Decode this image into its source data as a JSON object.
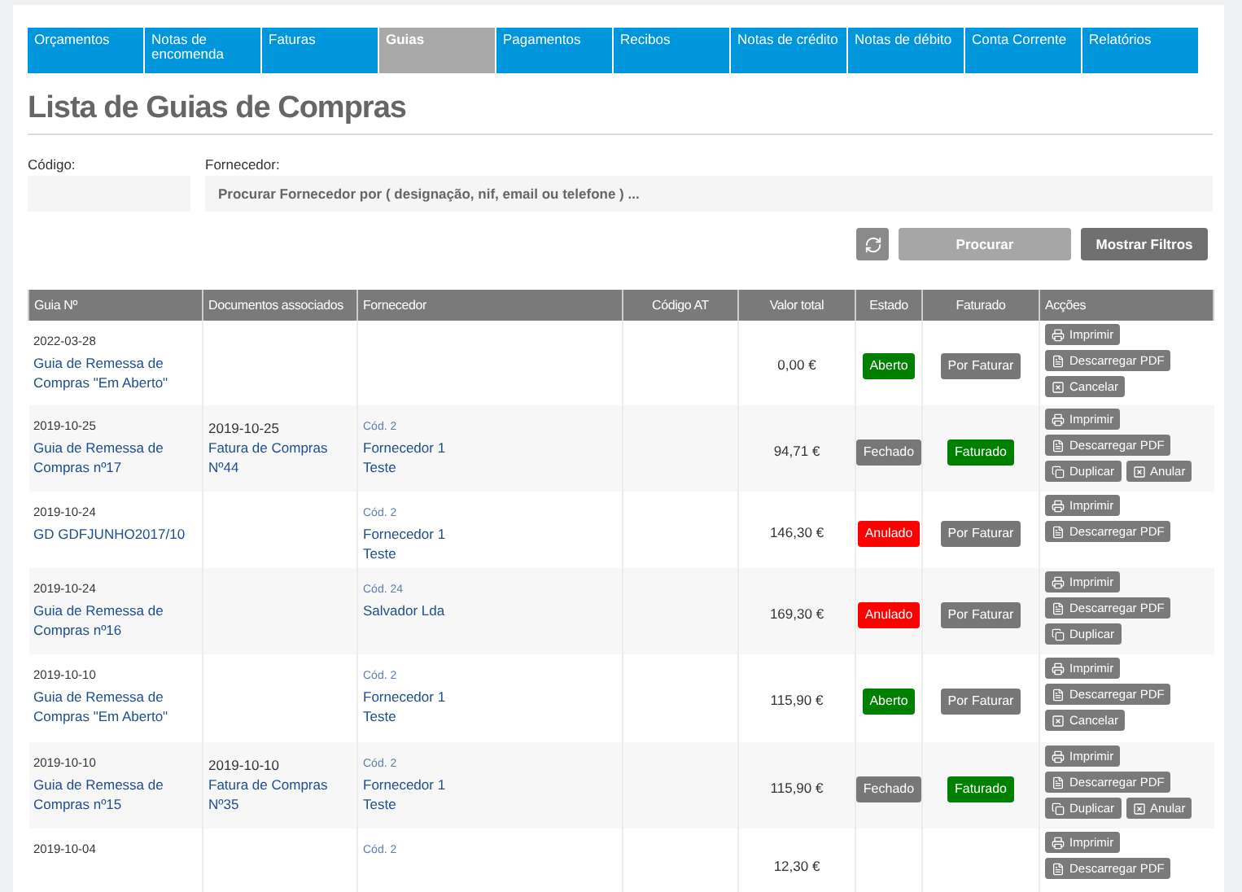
{
  "tabs": [
    {
      "label": "Orçamentos",
      "selected": false
    },
    {
      "label": "Notas de encomenda",
      "selected": false
    },
    {
      "label": "Faturas",
      "selected": false
    },
    {
      "label": "Guias",
      "selected": true
    },
    {
      "label": "Pagamentos",
      "selected": false
    },
    {
      "label": "Recibos",
      "selected": false
    },
    {
      "label": "Notas de crédito",
      "selected": false
    },
    {
      "label": "Notas de débito",
      "selected": false
    },
    {
      "label": "Conta Corrente",
      "selected": false
    },
    {
      "label": "Relatórios",
      "selected": false
    }
  ],
  "title": "Lista de Guias de Compras",
  "filters": {
    "code_label": "Código:",
    "supplier_label": "Fornecedor:",
    "supplier_placeholder": "Procurar Fornecedor por ( designação, nif, email ou telefone ) ...",
    "search_button": "Procurar",
    "filters_button": "Mostrar Filtros"
  },
  "table": {
    "columns": [
      "Guia Nº",
      "Documentos associados",
      "Fornecedor",
      "Código AT",
      "Valor total",
      "Estado",
      "Faturado",
      "Acções"
    ],
    "rows": [
      {
        "date": "2022-03-28",
        "title_lines": [
          "Guia de Remessa de",
          "Compras \"Em Aberto\""
        ],
        "total": "0,00 €",
        "status": {
          "label": "Aberto",
          "kind": "open"
        },
        "invoiced": {
          "label": "Por Faturar",
          "kind": "pending"
        },
        "actions": [
          {
            "label": "Imprimir",
            "kind": "print"
          },
          {
            "label": "Descarregar PDF",
            "kind": "pdf"
          },
          {
            "label": "Cancelar",
            "kind": "cancel"
          }
        ]
      },
      {
        "date": "2019-10-25",
        "title_lines": [
          "Guia de Remessa de",
          "Compras nº17"
        ],
        "doc": {
          "date": "2019-10-25",
          "title_lines": [
            "Fatura de Compras",
            "Nº44"
          ]
        },
        "supplier": {
          "code": "Cód. 2",
          "name_lines": [
            "Fornecedor 1",
            "Teste"
          ]
        },
        "total": "94,71 €",
        "status": {
          "label": "Fechado",
          "kind": "closed"
        },
        "invoiced": {
          "label": "Faturado",
          "kind": "done"
        },
        "actions": [
          {
            "label": "Imprimir",
            "kind": "print"
          },
          {
            "label": "Descarregar PDF",
            "kind": "pdf"
          },
          {
            "label": "Duplicar",
            "kind": "duplicate"
          },
          {
            "label": "Anular",
            "kind": "cancel"
          }
        ]
      },
      {
        "date": "2019-10-24",
        "title_lines": [
          "GD GDFJUNHO2017/10"
        ],
        "supplier": {
          "code": "Cód. 2",
          "name_lines": [
            "Fornecedor 1",
            "Teste"
          ]
        },
        "total": "146,30 €",
        "status": {
          "label": "Anulado",
          "kind": "void"
        },
        "invoiced": {
          "label": "Por Faturar",
          "kind": "pending"
        },
        "actions": [
          {
            "label": "Imprimir",
            "kind": "print"
          },
          {
            "label": "Descarregar PDF",
            "kind": "pdf"
          }
        ]
      },
      {
        "date": "2019-10-24",
        "title_lines": [
          "Guia de Remessa de",
          "Compras nº16"
        ],
        "supplier": {
          "code": "Cód. 24",
          "name_lines": [
            "Salvador Lda"
          ]
        },
        "total": "169,30 €",
        "status": {
          "label": "Anulado",
          "kind": "void"
        },
        "invoiced": {
          "label": "Por Faturar",
          "kind": "pending"
        },
        "actions": [
          {
            "label": "Imprimir",
            "kind": "print"
          },
          {
            "label": "Descarregar PDF",
            "kind": "pdf"
          },
          {
            "label": "Duplicar",
            "kind": "duplicate"
          }
        ]
      },
      {
        "date": "2019-10-10",
        "title_lines": [
          "Guia de Remessa de",
          "Compras \"Em Aberto\""
        ],
        "supplier": {
          "code": "Cód. 2",
          "name_lines": [
            "Fornecedor 1",
            "Teste"
          ]
        },
        "total": "115,90 €",
        "status": {
          "label": "Aberto",
          "kind": "open"
        },
        "invoiced": {
          "label": "Por Faturar",
          "kind": "pending"
        },
        "actions": [
          {
            "label": "Imprimir",
            "kind": "print"
          },
          {
            "label": "Descarregar PDF",
            "kind": "pdf"
          },
          {
            "label": "Cancelar",
            "kind": "cancel"
          }
        ]
      },
      {
        "date": "2019-10-10",
        "title_lines": [
          "Guia de Remessa de",
          "Compras nº15"
        ],
        "doc": {
          "date": "2019-10-10",
          "title_lines": [
            "Fatura de Compras",
            "Nº35"
          ]
        },
        "supplier": {
          "code": "Cód. 2",
          "name_lines": [
            "Fornecedor 1",
            "Teste"
          ]
        },
        "total": "115,90 €",
        "status": {
          "label": "Fechado",
          "kind": "closed"
        },
        "invoiced": {
          "label": "Faturado",
          "kind": "done"
        },
        "actions": [
          {
            "label": "Imprimir",
            "kind": "print"
          },
          {
            "label": "Descarregar PDF",
            "kind": "pdf"
          },
          {
            "label": "Duplicar",
            "kind": "duplicate"
          },
          {
            "label": "Anular",
            "kind": "cancel"
          }
        ]
      },
      {
        "date": "2019-10-04",
        "supplier": {
          "code": "Cód. 2"
        },
        "total": "12,30 €",
        "actions": [
          {
            "label": "Imprimir",
            "kind": "print"
          },
          {
            "label": "Descarregar PDF",
            "kind": "pdf"
          }
        ]
      }
    ]
  }
}
